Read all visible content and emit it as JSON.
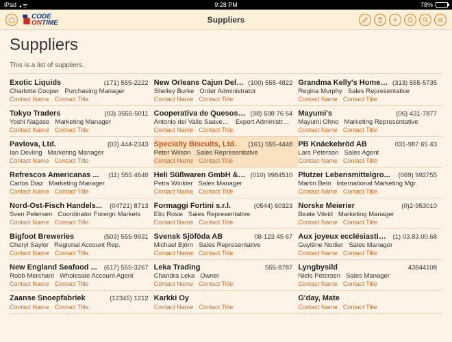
{
  "status": {
    "device": "iPad",
    "time": "9:28 PM",
    "battery_pct": "78%"
  },
  "nav": {
    "title": "Suppliers",
    "logo1": "CODE",
    "logo2": "ON",
    "logo3": "TIME"
  },
  "page": {
    "title": "Suppliers",
    "desc": "This is a list of suppliers."
  },
  "labels": {
    "contact_name": "Contact Name",
    "contact_title": "Contact Title"
  },
  "suppliers": [
    {
      "company": "Exotic Liquids",
      "phone": "(171) 555-2222",
      "contact": "Charlotte Cooper",
      "title": "Purchasing Manager",
      "sel": false
    },
    {
      "company": "New Orleans Cajun Deli...",
      "phone": "(100) 555-4822",
      "contact": "Shelley Burke",
      "title": "Order Administrator",
      "sel": false
    },
    {
      "company": "Grandma Kelly's Homes...",
      "phone": "(313) 555-5735",
      "contact": "Regina Murphy",
      "title": "Sales Representative",
      "sel": false
    },
    {
      "company": "Tokyo Traders",
      "phone": "(03) 3555-5011",
      "contact": "Yoshi Nagase",
      "title": "Marketing Manager",
      "sel": false
    },
    {
      "company": "Cooperativa de Quesos ...",
      "phone": "(98) 598 76 54",
      "contact": "Antonio del Valle Saavedra",
      "title": "Export Administrator",
      "sel": false
    },
    {
      "company": "Mayumi's",
      "phone": "(06) 431-7877",
      "contact": "Mayumi Ohno",
      "title": "Marketing Representative",
      "sel": false
    },
    {
      "company": "Pavlova, Ltd.",
      "phone": "(03) 444-2343",
      "contact": "Ian Devling",
      "title": "Marketing Manager",
      "sel": false
    },
    {
      "company": "Specialty Biscuits, Ltd.",
      "phone": "(161) 555-4448",
      "contact": "Peter Wilson",
      "title": "Sales Representative",
      "sel": true
    },
    {
      "company": "PB Knäckebröd AB",
      "phone": "031-987 65 43",
      "contact": "Lars Peterson",
      "title": "Sales Agent",
      "sel": false
    },
    {
      "company": "Refrescos Americanas ...",
      "phone": "(11) 555 4640",
      "contact": "Carlos Diaz",
      "title": "Marketing Manager",
      "sel": false
    },
    {
      "company": "Heli Süßwaren GmbH & ...",
      "phone": "(010) 9984510",
      "contact": "Petra Winkler",
      "title": "Sales Manager",
      "sel": false
    },
    {
      "company": "Plutzer Lebensmittelgro...",
      "phone": "(069) 992755",
      "contact": "Martin Bein",
      "title": "International Marketing Mgr.",
      "sel": false
    },
    {
      "company": "Nord-Ost-Fisch Handels...",
      "phone": "(04721) 8713",
      "contact": "Sven Petersen",
      "title": "Coordinator Foreign Markets",
      "sel": false
    },
    {
      "company": "Formaggi Fortini s.r.l.",
      "phone": "(0544) 60323",
      "contact": "Elio Rossi",
      "title": "Sales Representative",
      "sel": false
    },
    {
      "company": "Norske Meierier",
      "phone": "(0)2-953010",
      "contact": "Beate Vileid",
      "title": "Marketing Manager",
      "sel": false
    },
    {
      "company": "Bigfoot Breweries",
      "phone": "(503) 555-9931",
      "contact": "Cheryl Saylor",
      "title": "Regional Account Rep.",
      "sel": false
    },
    {
      "company": "Svensk Sjöföda AB",
      "phone": "08-123 45 67",
      "contact": "Michael Björn",
      "title": "Sales Representative",
      "sel": false
    },
    {
      "company": "Aux joyeux ecclésiastiq...",
      "phone": "(1) 03.83.00.68",
      "contact": "Guylène Nodier",
      "title": "Sales Manager",
      "sel": false
    },
    {
      "company": "New England Seafood ...",
      "phone": "(617) 555-3267",
      "contact": "Robb Merchant",
      "title": "Wholesale Account Agent",
      "sel": false
    },
    {
      "company": "Leka Trading",
      "phone": "555-8787",
      "contact": "Chandra Leka",
      "title": "Owner",
      "sel": false
    },
    {
      "company": "Lyngbysild",
      "phone": "43844108",
      "contact": "Niels Petersen",
      "title": "Sales Manager",
      "sel": false
    },
    {
      "company": "Zaanse Snoepfabriek",
      "phone": "(12345) 1212",
      "contact": "",
      "title": "",
      "sel": false
    },
    {
      "company": "Karkki Oy",
      "phone": "",
      "contact": "",
      "title": "",
      "sel": false
    },
    {
      "company": "G'day, Mate",
      "phone": "",
      "contact": "",
      "title": "",
      "sel": false
    }
  ]
}
